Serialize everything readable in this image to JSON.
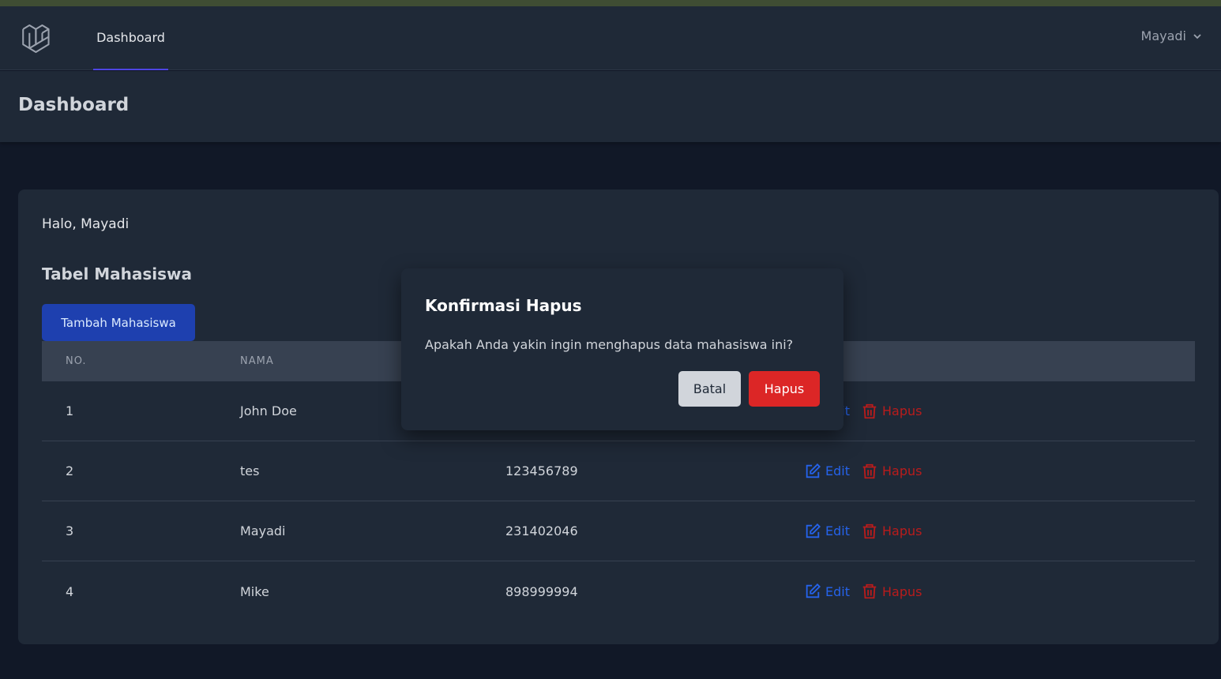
{
  "nav": {
    "link": "Dashboard",
    "user_name": "Mayadi"
  },
  "header": {
    "title": "Dashboard"
  },
  "content": {
    "greeting": "Halo, Mayadi",
    "section_title": "Tabel Mahasiswa",
    "add_button": "Tambah Mahasiswa",
    "table": {
      "headers": [
        "NO.",
        "NAMA"
      ],
      "rows": [
        {
          "no": "1",
          "nama": "John Doe",
          "nim": ""
        },
        {
          "no": "2",
          "nama": "tes",
          "nim": "123456789"
        },
        {
          "no": "3",
          "nama": "Mayadi",
          "nim": "231402046"
        },
        {
          "no": "4",
          "nama": "Mike",
          "nim": "898999994"
        }
      ],
      "edit_label": "Edit",
      "delete_label": "Hapus"
    }
  },
  "modal": {
    "title": "Konfirmasi Hapus",
    "message": "Apakah Anda yakin ingin menghapus data mahasiswa ini?",
    "cancel_label": "Batal",
    "confirm_label": "Hapus"
  },
  "colors": {
    "accent": "#4f46e5",
    "primary_button": "#1e40af",
    "edit": "#2563eb",
    "delete": "#b91c1c",
    "danger_button": "#dc2626"
  },
  "icons": {
    "logo": "laravel-logo",
    "user_chevron": "chevron-down-icon",
    "edit": "edit-icon",
    "delete": "trash-icon"
  }
}
